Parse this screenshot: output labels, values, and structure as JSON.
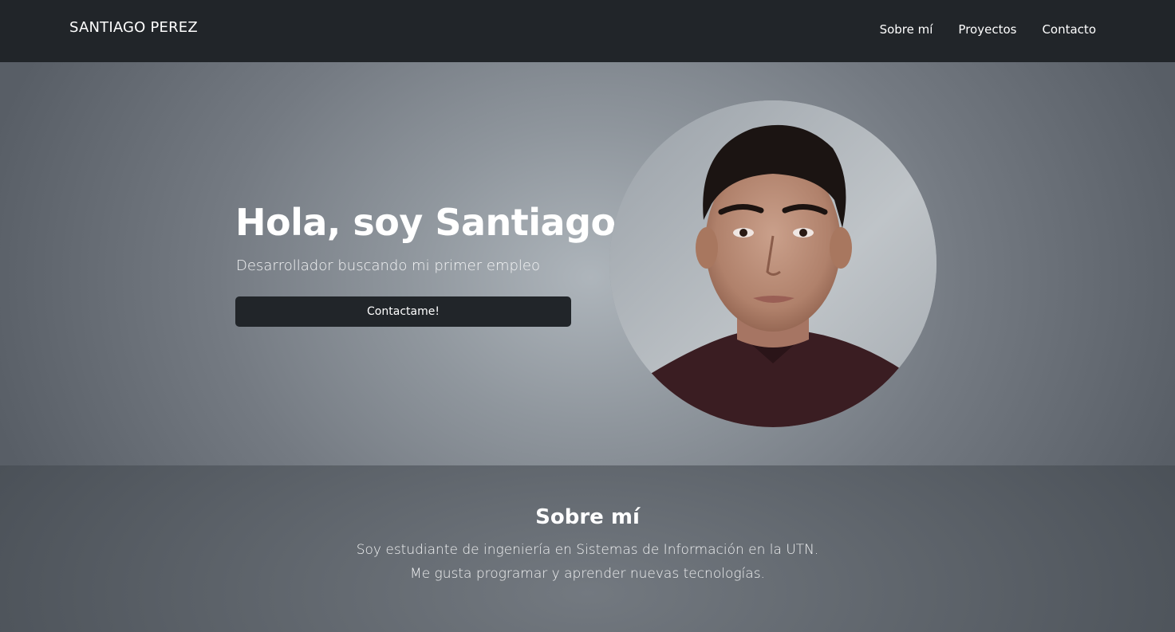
{
  "navbar": {
    "brand": "SANTIAGO PEREZ",
    "links": [
      "Sobre mí",
      "Proyectos",
      "Contacto"
    ]
  },
  "hero": {
    "title": "Hola, soy Santiago",
    "subtitle": "Desarrollador buscando mi primer empleo",
    "button_label": "Contactame!",
    "avatar_icon": "profile-photo"
  },
  "about": {
    "title": "Sobre mí",
    "lines": [
      "Soy estudiante de ingeniería en Sistemas de Información en la UTN.",
      "Me gusta programar y aprender nuevas tecnologías."
    ]
  },
  "colors": {
    "navbar_bg": "#212529",
    "button_bg": "#212529",
    "text": "#ffffff"
  }
}
